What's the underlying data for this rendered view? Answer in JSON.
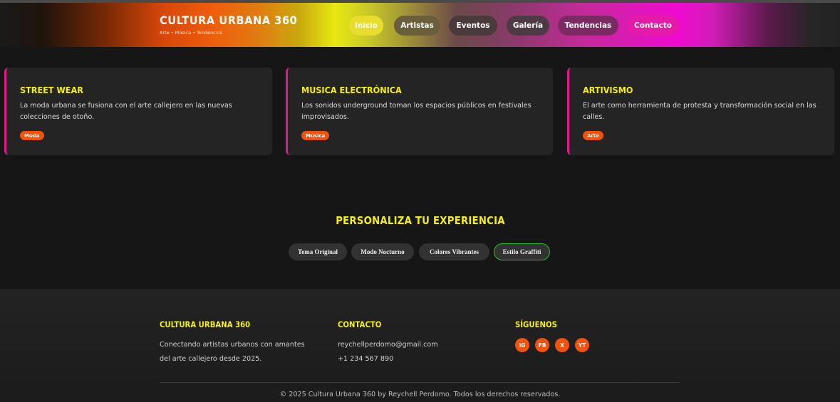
{
  "header": {
    "brand_title": "CULTURA URBANA 360",
    "brand_subtitle": "Arte • Música • Tendencias",
    "nav": [
      {
        "label": "Inicio",
        "bg": "#e8dd2e",
        "fg": "#ffffff"
      },
      {
        "label": "Artistas",
        "bg": "#6a5e3c",
        "fg": "#ffffff"
      },
      {
        "label": "Eventos",
        "bg": "#4a3a3c",
        "fg": "#ffffff"
      },
      {
        "label": "Galería",
        "bg": "#4e3a44",
        "fg": "#ffffff"
      },
      {
        "label": "Tendencias",
        "bg": "#7c2a62",
        "fg": "#ffffff"
      },
      {
        "label": "Contacto",
        "bg": "#e61aa8",
        "fg": "#ffffff"
      }
    ]
  },
  "cards": [
    {
      "title": "STREET WEAR",
      "text": "La moda urbana se fusiona con el arte callejero en las nuevas colecciones de otoño.",
      "tag": "Moda"
    },
    {
      "title": "MUSICA ELECTRÓNICA",
      "text": "Los sonidos underground toman los espacios públicos en festivales improvisados.",
      "tag": "Música"
    },
    {
      "title": "ARTIVISMO",
      "text": "El arte como herramienta de protesta y transformación social en las calles.",
      "tag": "Arte"
    }
  ],
  "personaliza": {
    "title": "PERSONALIZA TU EXPERIENCIA",
    "buttons": [
      {
        "label": "Tema Original",
        "active": false
      },
      {
        "label": "Modo Nocturno",
        "active": false
      },
      {
        "label": "Colores Vibrantes",
        "active": false
      },
      {
        "label": "Estilo Graffiti",
        "active": true
      }
    ]
  },
  "footer": {
    "about": {
      "title": "CULTURA URBANA 360",
      "line1": "Conectando artistas urbanos con amantes",
      "line2": "del arte callejero desde 2025."
    },
    "contact": {
      "title": "CONTACTO",
      "email": "reychellperdomo@gmail.com",
      "phone": "+1 234 567 890"
    },
    "social": {
      "title": "SÍGUENOS",
      "items": [
        "IG",
        "FB",
        "X",
        "YT"
      ]
    },
    "copyright": "© 2025 Cultura Urbana 360 by Reychell Perdomo. Todos los derechos reservados."
  },
  "colors": {
    "accent_yellow": "#f4ee12",
    "accent_orange": "#f2520c",
    "accent_pink": "#e01a8a",
    "active_green": "#22c322"
  }
}
